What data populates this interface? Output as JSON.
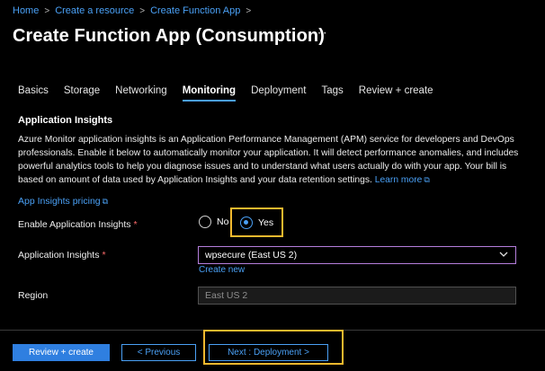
{
  "breadcrumb": [
    "Home",
    "Create a resource",
    "Create Function App"
  ],
  "page_title": "Create Function App (Consumption)",
  "more_label": "···",
  "tabs": [
    {
      "label": "Basics",
      "active": false
    },
    {
      "label": "Storage",
      "active": false
    },
    {
      "label": "Networking",
      "active": false
    },
    {
      "label": "Monitoring",
      "active": true
    },
    {
      "label": "Deployment",
      "active": false
    },
    {
      "label": "Tags",
      "active": false
    },
    {
      "label": "Review + create",
      "active": false
    }
  ],
  "section": {
    "title": "Application Insights",
    "description": "Azure Monitor application insights is an Application Performance Management (APM) service for developers and DevOps professionals. Enable it below to automatically monitor your application. It will detect performance anomalies, and includes powerful analytics tools to help you diagnose issues and to understand what users actually do with your app. Your bill is based on amount of data used by Application Insights and your data retention settings.",
    "learn_more": "Learn more"
  },
  "pricing_link": "App Insights pricing",
  "form": {
    "enable_label": "Enable Application Insights",
    "required_mark": "*",
    "option_no": "No",
    "option_yes": "Yes",
    "selected": "Yes",
    "appinsights_label": "Application Insights",
    "appinsights_value": "wpsecure (East US 2)",
    "create_new": "Create new",
    "region_label": "Region",
    "region_value": "East US 2"
  },
  "footer": {
    "review_create": "Review + create",
    "previous": "< Previous",
    "next": "Next : Deployment >"
  },
  "colors": {
    "accent": "#4aa0f5",
    "highlight": "#f5b92e",
    "required": "#ff6b6b",
    "select_border": "#b57edc"
  }
}
